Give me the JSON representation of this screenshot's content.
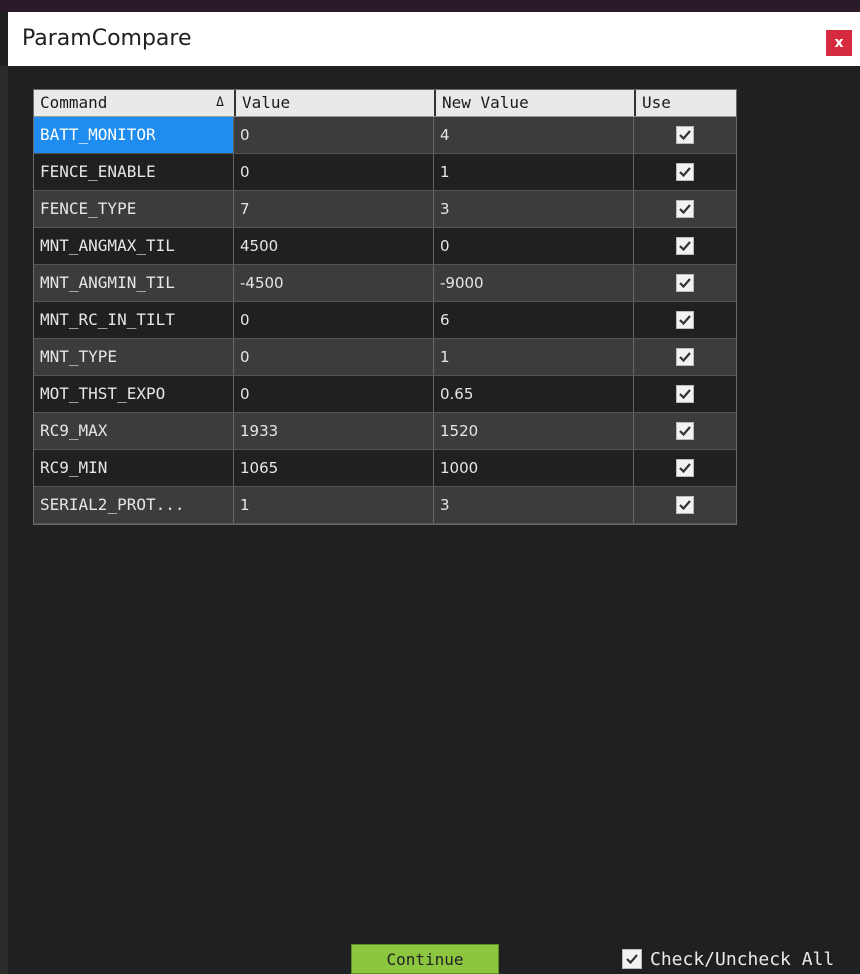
{
  "window": {
    "title": "ParamCompare",
    "close_label": "x"
  },
  "table": {
    "headers": {
      "command": "Command",
      "sort_indicator": "Δ",
      "value": "Value",
      "new_value": "New Value",
      "use": "Use"
    },
    "rows": [
      {
        "command": "BATT_MONITOR",
        "value": "0",
        "new_value": "4",
        "use": true,
        "selected": true
      },
      {
        "command": "FENCE_ENABLE",
        "value": "0",
        "new_value": "1",
        "use": true
      },
      {
        "command": "FENCE_TYPE",
        "value": "7",
        "new_value": "3",
        "use": true
      },
      {
        "command": "MNT_ANGMAX_TIL",
        "value": "4500",
        "new_value": "0",
        "use": true
      },
      {
        "command": "MNT_ANGMIN_TIL",
        "value": "-4500",
        "new_value": "-9000",
        "use": true
      },
      {
        "command": "MNT_RC_IN_TILT",
        "value": "0",
        "new_value": "6",
        "use": true
      },
      {
        "command": "MNT_TYPE",
        "value": "0",
        "new_value": "1",
        "use": true
      },
      {
        "command": "MOT_THST_EXPO",
        "value": "0",
        "new_value": "0.65",
        "use": true
      },
      {
        "command": "RC9_MAX",
        "value": "1933",
        "new_value": "1520",
        "use": true
      },
      {
        "command": "RC9_MIN",
        "value": "1065",
        "new_value": "1000",
        "use": true
      },
      {
        "command": "SERIAL2_PROT...",
        "value": "1",
        "new_value": "3",
        "use": true
      }
    ]
  },
  "footer": {
    "continue_label": "Continue",
    "check_all_label": "Check/Uncheck All",
    "check_all_checked": true
  },
  "colors": {
    "selection": "#1f8cf0",
    "continue_button": "#8cc63f",
    "close_button": "#d62b3f"
  }
}
